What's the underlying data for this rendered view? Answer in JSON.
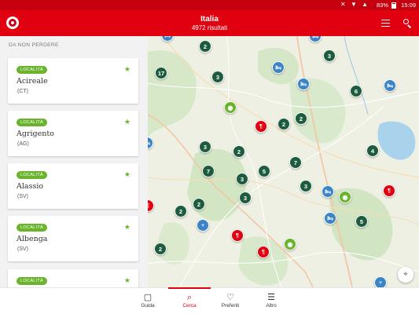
{
  "status_bar": {
    "battery": "83%",
    "time": "15:09"
  },
  "app_bar": {
    "title": "Italia",
    "subtitle": "4972 risultati"
  },
  "sidebar": {
    "section_title": "DA NON PERDERE",
    "cards": [
      {
        "badge": "LOCALITÀ",
        "name": "Acireale",
        "province": "(CT)"
      },
      {
        "badge": "LOCALITÀ",
        "name": "Agrigento",
        "province": "(AG)"
      },
      {
        "badge": "LOCALITÀ",
        "name": "Alassio",
        "province": "(SV)"
      },
      {
        "badge": "LOCALITÀ",
        "name": "Albenga",
        "province": "(SV)"
      },
      {
        "badge": "LOCALITÀ",
        "name": "",
        "province": ""
      }
    ]
  },
  "map": {
    "cluster_counts": [
      "2",
      "3",
      "17",
      "3",
      "6",
      "2",
      "2",
      "4",
      "3",
      "2",
      "7",
      "7",
      "5",
      "3",
      "3",
      "3",
      "2",
      "2",
      "5",
      "2"
    ],
    "lake_color": "#a9d3ec"
  },
  "bottom_nav": {
    "items": [
      {
        "label": "Guida",
        "icon": "book-icon"
      },
      {
        "label": "Cerca",
        "icon": "map-search-icon"
      },
      {
        "label": "Preferiti",
        "icon": "heart-icon"
      },
      {
        "label": "Altro",
        "icon": "menu-icon"
      }
    ],
    "active": "Cerca"
  },
  "colors": {
    "brand_red": "#e1000f",
    "cluster_green": "#1d5c3e",
    "badge_green": "#6ab42d",
    "hotel_blue": "#3b84c6"
  }
}
